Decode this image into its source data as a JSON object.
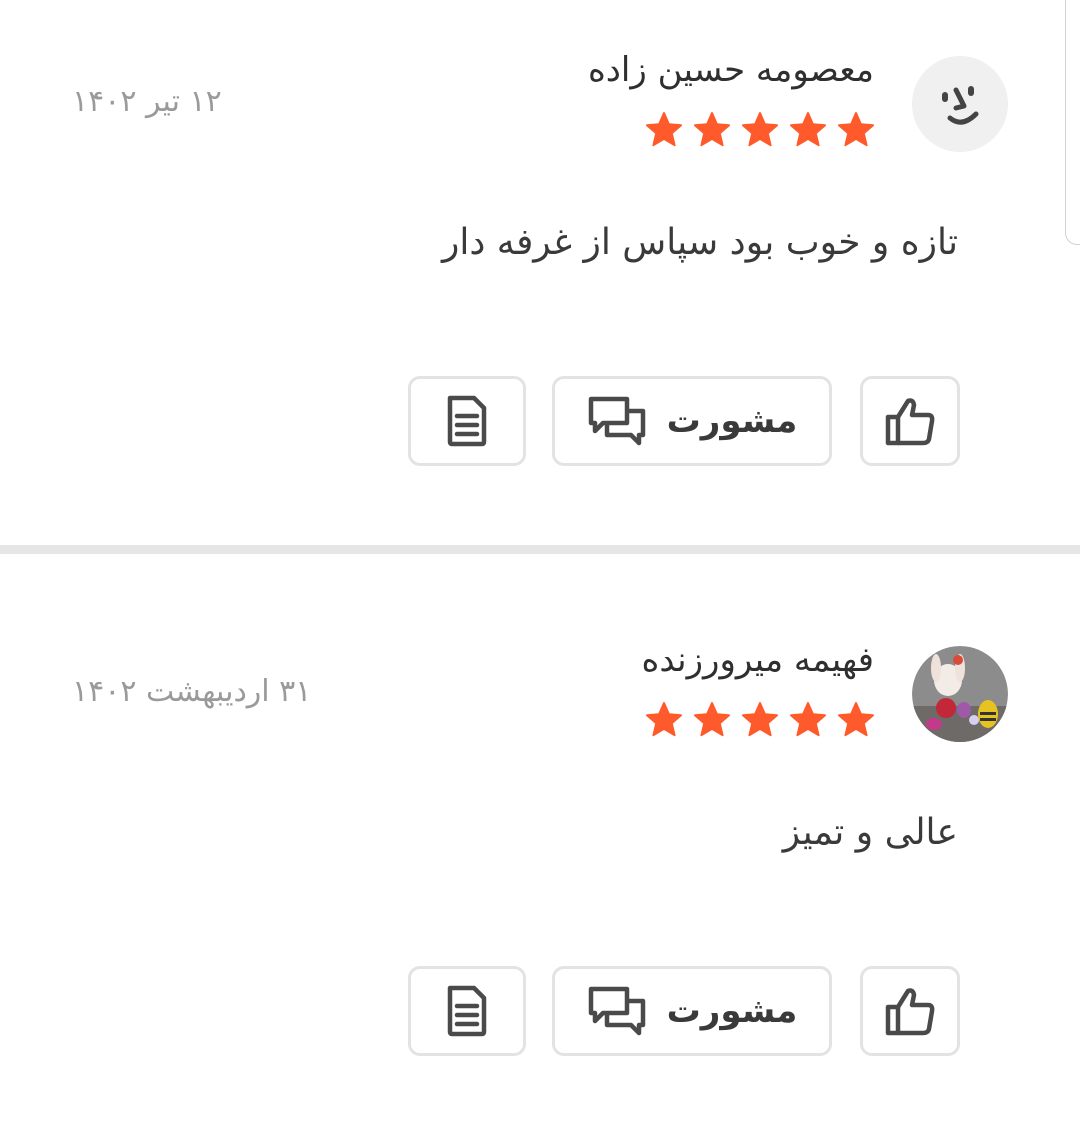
{
  "reviews": [
    {
      "author": "معصومه حسین زاده",
      "date": "۱۲ تیر ۱۴۰۲",
      "rating": 5,
      "comment": "تازه و خوب بود سپاس از غرفه دار",
      "avatar": "smiley-face-icon",
      "actions": {
        "reply_label": "مشورت"
      }
    },
    {
      "author": "فهیمه میرورزنده",
      "date": "۳۱ اردیبهشت ۱۴۰۲",
      "rating": 5,
      "comment": "عالی و تمیز",
      "avatar": "user-photo-plush-toys",
      "actions": {
        "reply_label": "مشورت"
      }
    }
  ],
  "colors": {
    "star": "#ff5a2c",
    "border": "#e3e3e3",
    "divider": "#e6e6e6",
    "icon": "#4a4a4a",
    "date_text": "#9a9a9a"
  },
  "icons": {
    "like": "thumbs-up-icon",
    "reply": "chat-bubbles-icon",
    "report": "document-icon",
    "star": "star-icon"
  }
}
